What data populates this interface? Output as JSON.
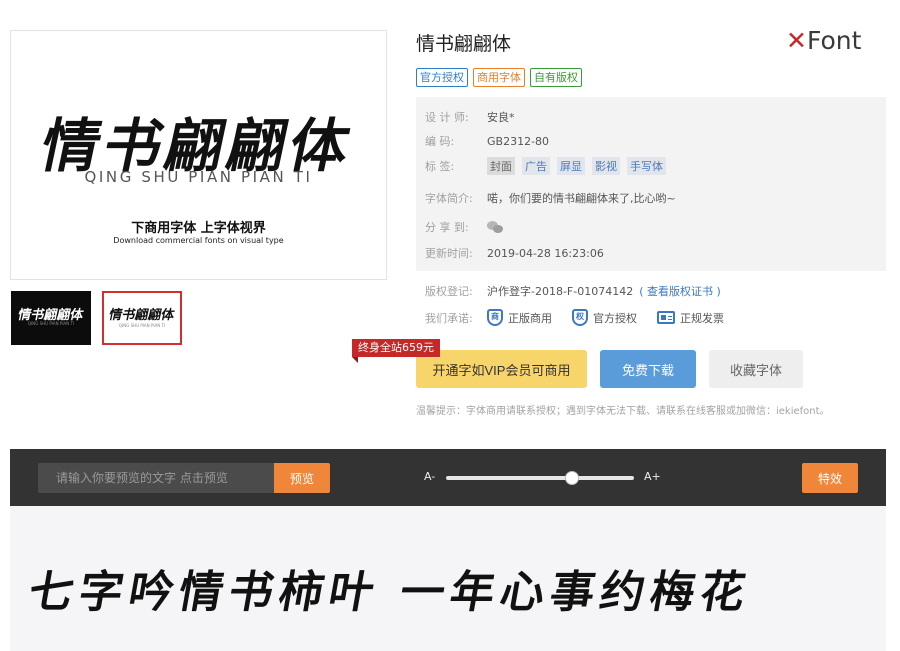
{
  "preview_image": {
    "title": "情书翩翩体",
    "pinyin": "QING SHU PIAN PIAN TI",
    "promo": "下商用字体 上字体视界",
    "promo_en": "Download commercial fonts on visual type"
  },
  "thumbnails": [
    {
      "title": "情书翩翩体",
      "sub": "QING SHU PIAN PIAN TI"
    },
    {
      "title": "情书翩翩体",
      "sub": "QING SHU PIAN PIAN TI"
    }
  ],
  "font": {
    "title": "情书翩翩体",
    "tags": [
      "官方授权",
      "商用字体",
      "自有版权"
    ]
  },
  "brand": {
    "x": "✕",
    "name": "Font"
  },
  "details": {
    "designer": {
      "label": "设 计 师:",
      "value": "安良*"
    },
    "code": {
      "label": "编 码:",
      "value": "GB2312-80"
    },
    "keywords": {
      "label": "标 签:",
      "items": [
        "封面",
        "广告",
        "屏显",
        "影视",
        "手写体"
      ]
    },
    "intro": {
      "label": "字体简介:",
      "value": "喏，你们要的情书翩翩体来了,比心哟~"
    },
    "share": {
      "label": "分 享 到:",
      "icon": "wechat-icon"
    },
    "updated": {
      "label": "更新时间:",
      "value": "2019-04-28 16:23:06"
    }
  },
  "copyright": {
    "label": "版权登记:",
    "value": "沪作登字-2018-F-01074142",
    "link": "( 查看版权证书 )"
  },
  "promises": {
    "label": "我们承诺:",
    "items": [
      {
        "icon": "genuine-shield-icon",
        "glyph": "商",
        "text": "正版商用"
      },
      {
        "icon": "authorized-shield-icon",
        "glyph": "权",
        "text": "官方授权"
      },
      {
        "icon": "invoice-icon",
        "glyph": "",
        "text": "正规发票"
      }
    ]
  },
  "actions": {
    "price_badge": "终身全站659元",
    "vip": "开通字如VIP会员可商用",
    "download": "免费下载",
    "collect": "收藏字体"
  },
  "tip": "温馨提示：字体商用请联系授权；遇到字体无法下载、请联系在线客服或加微信：iekiefont。",
  "toolbar": {
    "input_placeholder": "请输入你要预览的文字 点击预览",
    "preview_button": "预览",
    "size_minus": "A-",
    "size_plus": "A+",
    "size_level": 0.67,
    "effect_button": "特效"
  },
  "sample_text": "七字吟情书柿叶 一年心事约梅花"
}
